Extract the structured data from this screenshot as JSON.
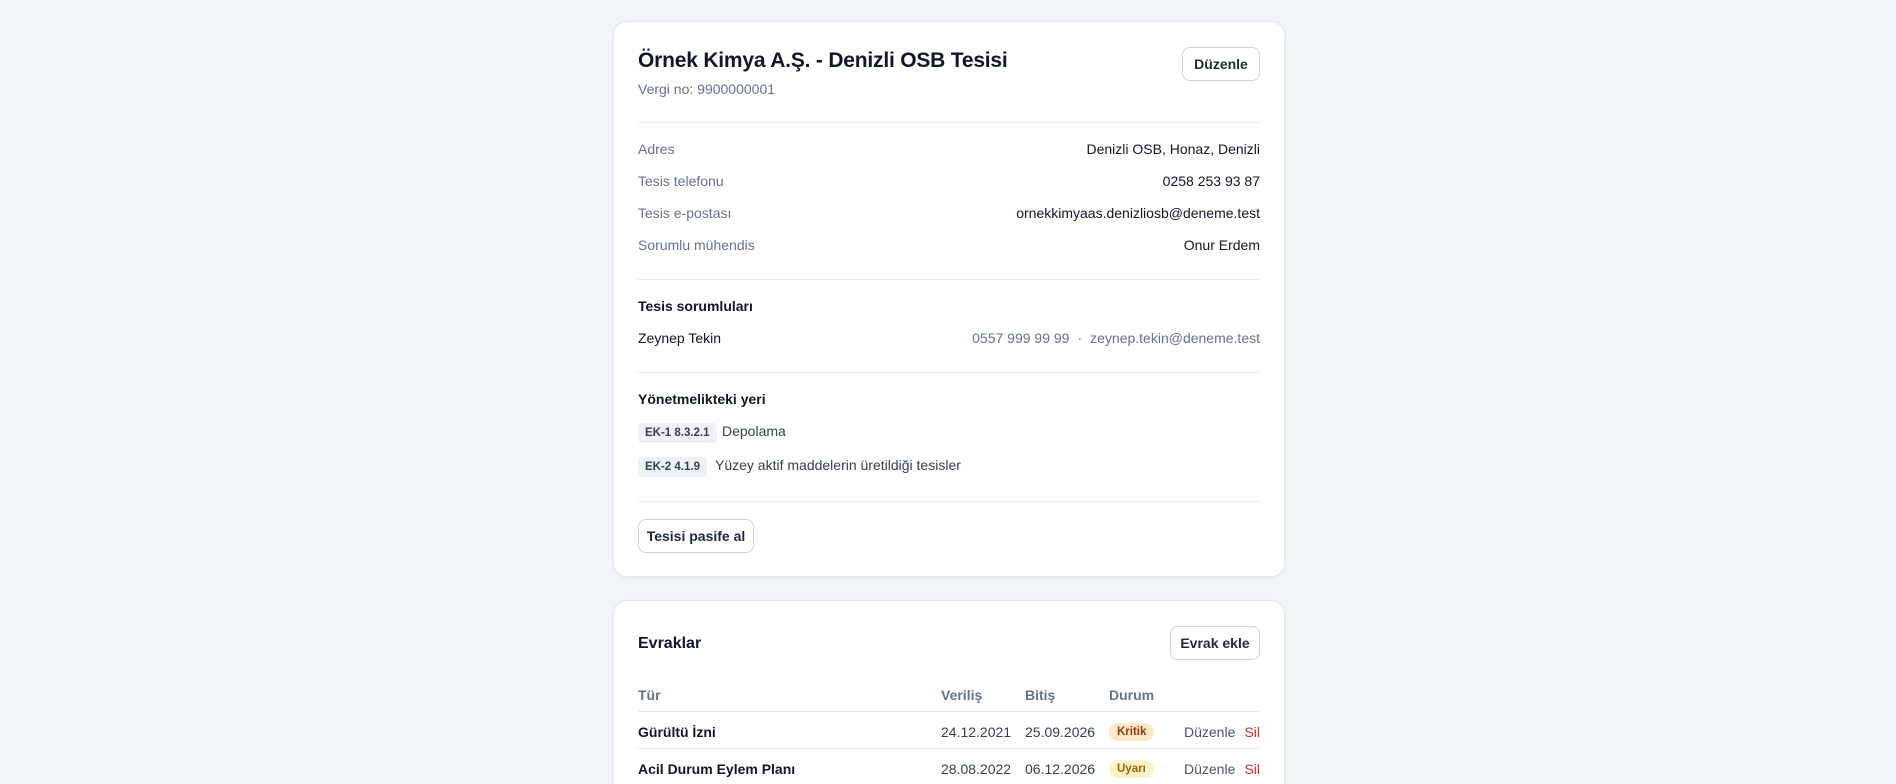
{
  "facility": {
    "title": "Örnek Kimya A.Ş. - Denizli OSB Tesisi",
    "tax_no": "Vergi no: 9900000001",
    "edit_label": "Düzenle",
    "details": [
      {
        "label": "Adres",
        "value": "Denizli OSB, Honaz, Denizli"
      },
      {
        "label": "Tesis telefonu",
        "value": "0258 253 93 87"
      },
      {
        "label": "Tesis e-postası",
        "value": "ornekkimyaas.denizliosb@deneme.test"
      },
      {
        "label": "Sorumlu mühendis",
        "value": "Onur Erdem"
      }
    ],
    "responsibles_heading": "Tesis sorumluları",
    "responsible": {
      "name": "Zeynep Tekin",
      "phone": "0557 999 99 99",
      "separator": "·",
      "email": "zeynep.tekin@deneme.test"
    },
    "regulation_heading": "Yönetmelikteki yeri",
    "regulations": [
      {
        "code": "EK-1 8.3.2.1",
        "text": "Depolama"
      },
      {
        "code": "EK-2 4.1.9",
        "text": "Yüzey aktif maddelerin üretildiği tesisler"
      }
    ],
    "deactivate_label": "Tesisi pasife al"
  },
  "documents": {
    "title": "Evraklar",
    "add_label": "Evrak ekle",
    "columns": [
      "Tür",
      "Veriliş",
      "Bitiş",
      "Durum"
    ],
    "rows": [
      {
        "type": "Gürültü İzni",
        "issued": "24.12.2021",
        "expires": "25.09.2026",
        "status": "Kritik",
        "edit": "Düzenle",
        "delete": "Sil"
      },
      {
        "type": "Acil Durum Eylem Planı",
        "issued": "28.08.2022",
        "expires": "06.12.2026",
        "status": "Uyarı",
        "edit": "Düzenle",
        "delete": "Sil"
      }
    ]
  },
  "colors": {
    "critical_bg": "#fde7c7",
    "critical_text": "#9a3412",
    "warning_bg": "#fef3c7",
    "warning_text": "#a16207",
    "delete_red": "#dc2626"
  }
}
